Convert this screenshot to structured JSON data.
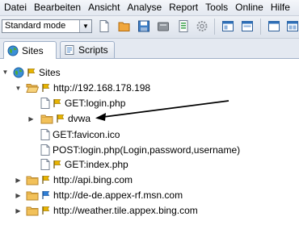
{
  "menu": [
    "Datei",
    "Bearbeiten",
    "Ansicht",
    "Analyse",
    "Report",
    "Tools",
    "Online",
    "Hilfe"
  ],
  "toolbar": {
    "mode": "Standard mode"
  },
  "tabs": {
    "sites": "Sites",
    "scripts": "Scripts"
  },
  "tree": {
    "root": "Sites",
    "host1": "http://192.168.178.198",
    "n_login_get": "GET:login.php",
    "n_dvwa": "dvwa",
    "n_favicon": "GET:favicon.ico",
    "n_login_post": "POST:login.php(Login,password,username)",
    "n_index": "GET:index.php",
    "host2": "http://api.bing.com",
    "host3": "http://de-de.appex-rf.msn.com",
    "host4": "http://weather.tile.appex.bing.com"
  },
  "icons": {
    "flag_color": "#e8b400",
    "blue_flag_color": "#2f7fd6",
    "folder_color": "#f2c15a"
  }
}
